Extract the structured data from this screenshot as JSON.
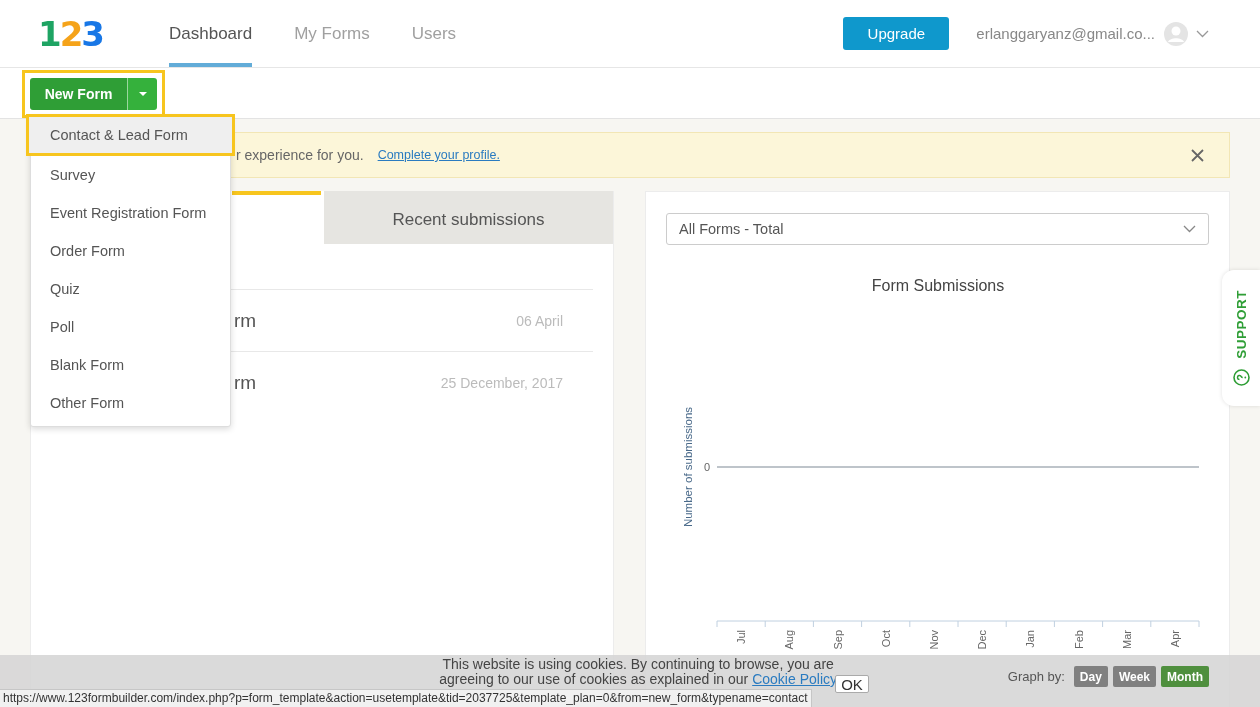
{
  "header": {
    "logo": [
      {
        "text": "1",
        "color": "#1ea463"
      },
      {
        "text": "2",
        "color": "#f5a31a"
      },
      {
        "text": "3",
        "color": "#1877e6"
      }
    ],
    "nav": [
      {
        "label": "Dashboard",
        "selected": true
      },
      {
        "label": "My Forms",
        "selected": false
      },
      {
        "label": "Users",
        "selected": false
      }
    ],
    "upgrade_button": "Upgrade",
    "account_email": "erlanggaryanz@gmail.co..."
  },
  "toolbar": {
    "new_form_button": "New Form",
    "highlighted": true
  },
  "new_form_menu": {
    "items": [
      {
        "label": "Contact & Lead Form",
        "selected": true
      },
      {
        "label": "Survey",
        "selected": false
      },
      {
        "label": "Event Registration Form",
        "selected": false
      },
      {
        "label": "Order Form",
        "selected": false
      },
      {
        "label": "Quiz",
        "selected": false
      },
      {
        "label": "Poll",
        "selected": false
      },
      {
        "label": "Blank Form",
        "selected": false
      },
      {
        "label": "Other Form",
        "selected": false
      }
    ]
  },
  "notice": {
    "text": "r experience for you.",
    "link": "Complete your profile."
  },
  "forms_panel": {
    "tabs": [
      {
        "selected": true
      },
      {
        "label": "Recent submissions",
        "selected": false
      }
    ],
    "rows": [
      {
        "name": "rm",
        "date": "06 April"
      },
      {
        "name": "rm",
        "date": "25 December, 2017"
      }
    ]
  },
  "chart_panel": {
    "form_select": {
      "value": "All Forms - Total"
    },
    "chart": {
      "title": "Form Submissions",
      "ylabel": "Number of submissions",
      "y_tick": "0",
      "x_labels": [
        "Jul",
        "Aug",
        "Sep",
        "Oct",
        "Nov",
        "Dec",
        "Jan",
        "Feb",
        "Mar",
        "Apr"
      ]
    },
    "graph_by": {
      "label": "Graph by:",
      "options": [
        {
          "label": "Day",
          "selected": false
        },
        {
          "label": "Week",
          "selected": false
        },
        {
          "label": "Month",
          "selected": true
        }
      ]
    }
  },
  "support_tab": {
    "label": "SUPPORT"
  },
  "cookie_notice": {
    "text": "This website is using cookies. By continuing to browse, you are agreeing to our use of cookies as explained in our",
    "link": "Cookie Policy",
    "ok_button": "OK"
  },
  "status_url": "https://www.123formbuilder.com/index.php?p=form_template&action=usetemplate&tid=2037725&template_plan=0&from=new_form&typename=contact"
}
